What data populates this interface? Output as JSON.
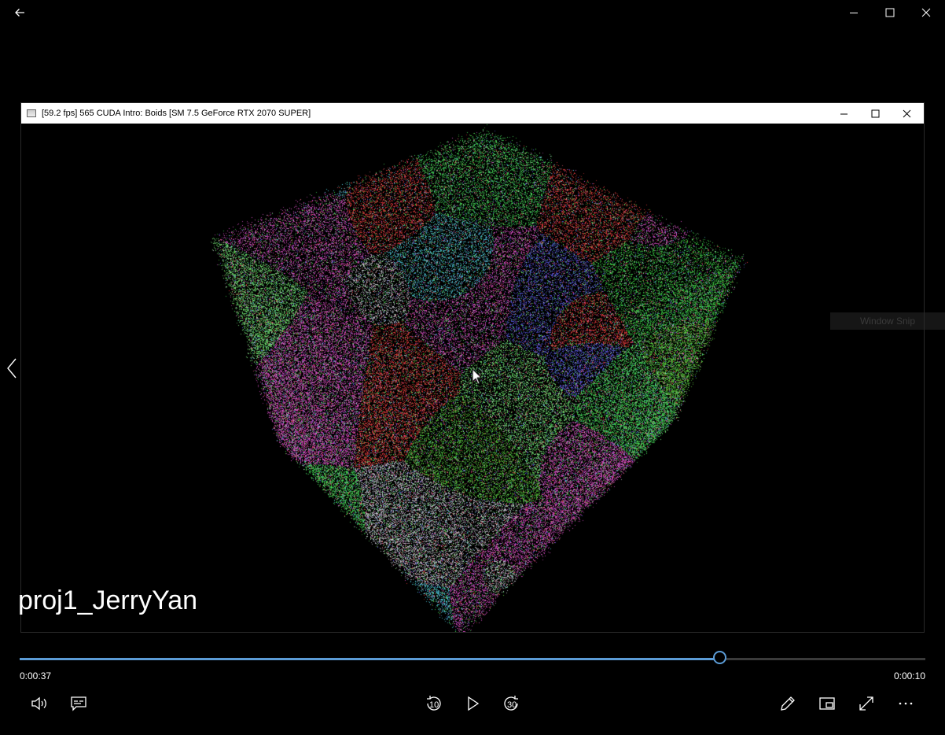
{
  "player": {
    "back_icon": "arrow-left-icon",
    "window_controls": [
      "minimize-icon",
      "maximize-icon",
      "close-icon"
    ]
  },
  "app_window": {
    "title": "[59.2 fps] 565 CUDA Intro: Boids [SM 7.5 GeForce RTX 2070 SUPER]",
    "icon": "app-icon"
  },
  "ghost_tooltip": "Window Snip",
  "caption": "proj1_JerryYan",
  "playback": {
    "elapsed": "0:00:37",
    "remaining": "0:00:10",
    "progress_fraction": 0.7736,
    "rewind_seconds": "10",
    "forward_seconds": "30"
  },
  "controls": {
    "left": [
      "volume-icon",
      "subtitles-icon"
    ],
    "center": [
      "rewind-10-icon",
      "play-icon",
      "forward-30-icon"
    ],
    "right": [
      "pencil-icon",
      "mini-view-icon",
      "fullscreen-icon",
      "more-icon"
    ]
  },
  "colors": {
    "accent": "#5b9bd5",
    "background": "#000000"
  }
}
